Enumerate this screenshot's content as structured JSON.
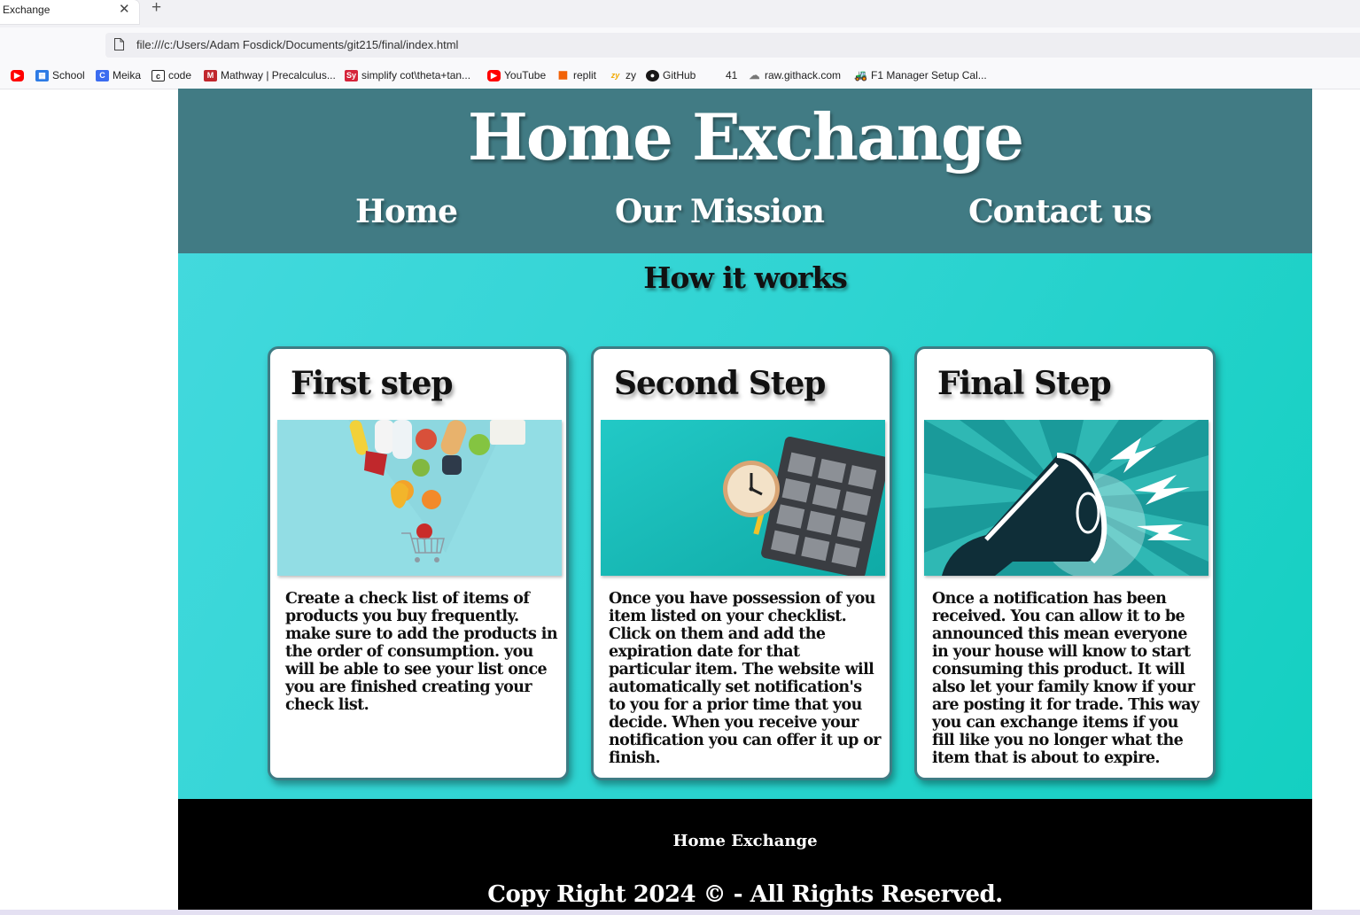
{
  "browser": {
    "tab_title": "Exchange",
    "tab_close": "✕",
    "new_tab": "+",
    "address": "file:///c:/Users/Adam Fosdick/Documents/git215/final/index.html",
    "bookmarks": [
      {
        "label": "",
        "icon": "youtube-icon",
        "color": "#ff0000"
      },
      {
        "label": "School",
        "icon": "school-grid-icon",
        "color": "#2d7be5"
      },
      {
        "label": "Meika",
        "icon": "meika-c-icon",
        "color": "#3b6cf0"
      },
      {
        "label": "code",
        "icon": "code-icon",
        "color": "#222222"
      },
      {
        "label": "Mathway | Precalculus...",
        "icon": "mathway-icon",
        "color": "#c1272d"
      },
      {
        "label": "simplify cot\\theta+tan...",
        "icon": "symbolab-icon",
        "color": "#d6243b"
      },
      {
        "label": "YouTube",
        "icon": "youtube-icon",
        "color": "#ff0000"
      },
      {
        "label": "replit",
        "icon": "replit-icon",
        "color": "#f26207"
      },
      {
        "label": "zy",
        "icon": "zybooks-icon",
        "color": "#f2a900"
      },
      {
        "label": "GitHub",
        "icon": "github-icon",
        "color": "#181717"
      },
      {
        "label": "41",
        "icon": "",
        "color": ""
      },
      {
        "label": "raw.githack.com",
        "icon": "githack-icon",
        "color": "#777777"
      },
      {
        "label": "F1 Manager Setup Cal...",
        "icon": "tractor-icon",
        "color": "#3a8a2e"
      }
    ]
  },
  "site": {
    "title": "Home Exchange",
    "nav": [
      "Home",
      "Our Mission",
      "Contact us"
    ],
    "section_title": "How it works",
    "cards": [
      {
        "heading": "First step",
        "image": "groceries-cart-image",
        "text": "Create a check list of items of products you buy frequently. make sure to add the products in the order of consumption. you will be able to see your list once you are finished creating your check list."
      },
      {
        "heading": "Second Step",
        "image": "clock-calendar-image",
        "text": "Once you have possession of you item listed on your checklist. Click on them and add the expiration date for that particular item. The website will automatically set notification's to you for a prior time that you decide. When you receive your notification you can offer it up or finish."
      },
      {
        "heading": "Final Step",
        "image": "megaphone-image",
        "text": "Once a notification has been received. You can allow it to be announced this mean everyone in your house will know to start consuming this product. It will also let your family know if your are posting it for trade. This way you can exchange items if you fill like you no longer what the item that is about to expire."
      }
    ],
    "footer_name": "Home Exchange",
    "footer_copy": "Copy Right 2024 © - All Rights Reserved."
  },
  "colors": {
    "header_bg": "#417b84",
    "main_bg": "#2fd4d2",
    "footer_bg": "#000000",
    "card_border": "#3e7c84"
  }
}
